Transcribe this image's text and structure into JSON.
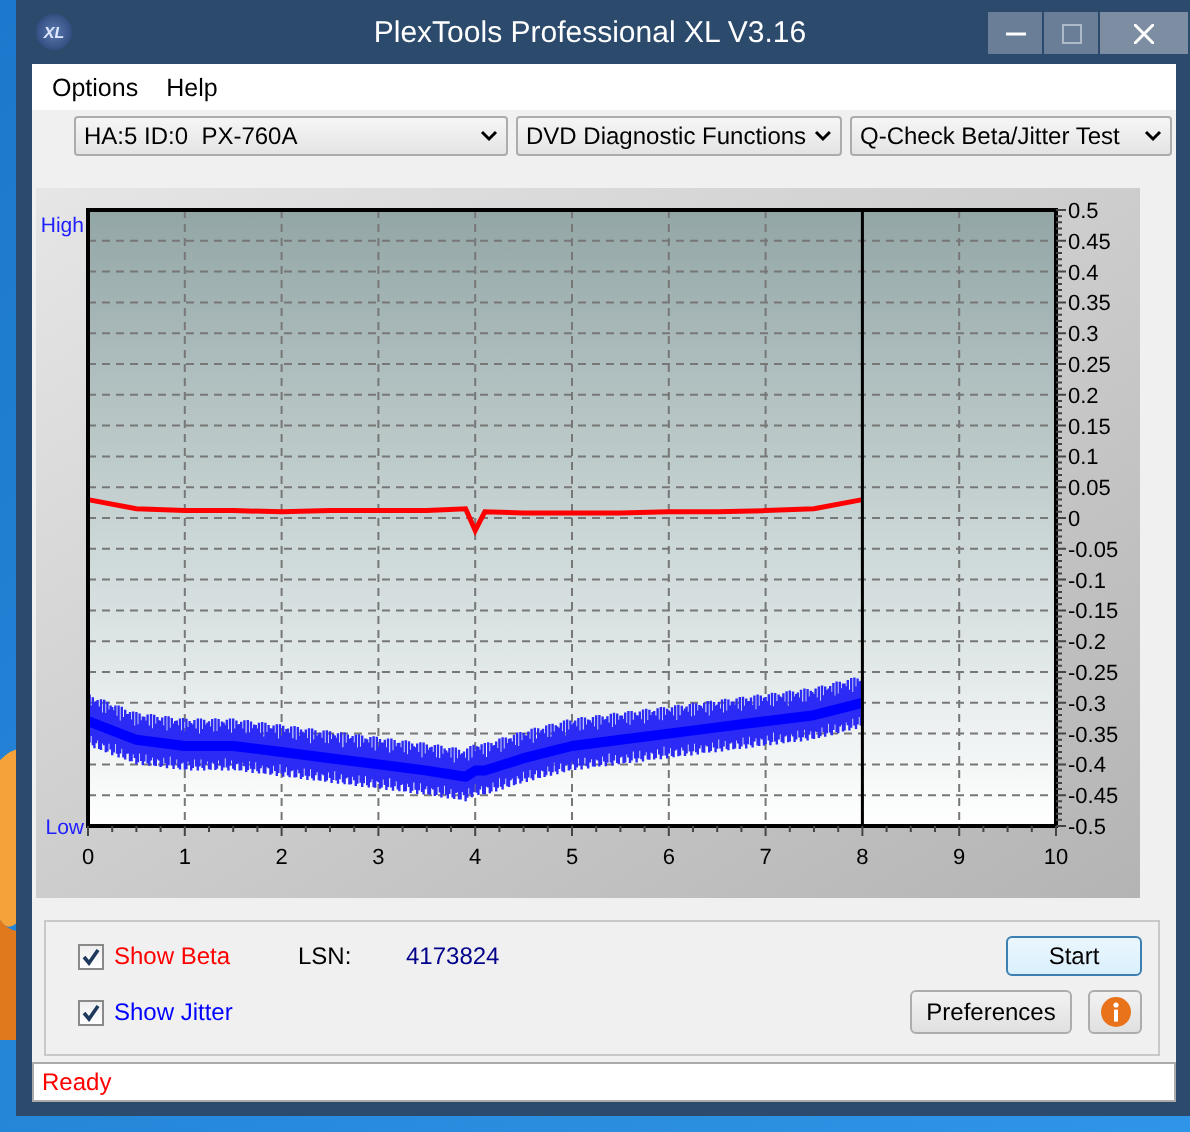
{
  "window": {
    "title": "PlexTools Professional XL V3.16",
    "icon_label": "XL",
    "controls": [
      {
        "kind": "minimize",
        "disabled": false
      },
      {
        "kind": "maximize",
        "disabled": true
      },
      {
        "kind": "close",
        "disabled": false
      }
    ]
  },
  "menu": [
    "Options",
    "Help"
  ],
  "dropdowns": [
    {
      "value": "HA:5 ID:0  PX-760A"
    },
    {
      "value": "DVD Diagnostic Functions"
    },
    {
      "value": "Q-Check Beta/Jitter Test"
    }
  ],
  "chart": {
    "high_label": "High",
    "low_label": "Low",
    "chart_data": {
      "type": "line",
      "grid": true,
      "ref_lines": [
        {
          "axis": "x",
          "value": 8,
          "color": "#000000"
        }
      ],
      "x": [
        0,
        0.5,
        1,
        1.5,
        2,
        2.5,
        3,
        3.5,
        3.9,
        4,
        4.1,
        4.5,
        5,
        5.5,
        6,
        6.5,
        7,
        7.5,
        8
      ],
      "series": [
        {
          "color": "#ff0000",
          "values": [
            0.03,
            0.015,
            0.012,
            0.012,
            0.01,
            0.012,
            0.012,
            0.012,
            0.015,
            -0.02,
            0.01,
            0.008,
            0.008,
            0.008,
            0.01,
            0.01,
            0.012,
            0.015,
            0.03
          ]
        },
        {
          "color": "#0000ff",
          "values": [
            -0.33,
            -0.36,
            -0.37,
            -0.37,
            -0.38,
            -0.39,
            -0.4,
            -0.41,
            -0.42,
            -0.41,
            -0.41,
            -0.39,
            -0.37,
            -0.36,
            -0.35,
            -0.34,
            -0.33,
            -0.32,
            -0.3
          ]
        }
      ],
      "xlim": [
        0,
        10
      ],
      "ylim": [
        -0.5,
        0.5
      ],
      "xticks": [
        0,
        1,
        2,
        3,
        4,
        5,
        6,
        7,
        8,
        9,
        10
      ],
      "yticks": [
        {
          "value": 0.5,
          "label": "0.5"
        },
        {
          "value": 0.45,
          "label": "0.45"
        },
        {
          "value": 0.4,
          "label": "0.4"
        },
        {
          "value": 0.35,
          "label": "0.35"
        },
        {
          "value": 0.3,
          "label": "0.3"
        },
        {
          "value": 0.25,
          "label": "0.25"
        },
        {
          "value": 0.2,
          "label": "0.2"
        },
        {
          "value": 0.15,
          "label": "0.15"
        },
        {
          "value": 0.1,
          "label": "0.1"
        },
        {
          "value": 0.05,
          "label": "0.05"
        },
        {
          "value": 0,
          "label": "0"
        },
        {
          "value": -0.05,
          "label": "-0.05"
        },
        {
          "value": -0.1,
          "label": "-0.1"
        },
        {
          "value": -0.15,
          "label": "-0.15"
        },
        {
          "value": -0.2,
          "label": "-0.2"
        },
        {
          "value": -0.25,
          "label": "-0.25"
        },
        {
          "value": -0.3,
          "label": "-0.3"
        },
        {
          "value": -0.35,
          "label": "-0.35"
        },
        {
          "value": -0.4,
          "label": "-0.4"
        },
        {
          "value": -0.45,
          "label": "-0.45"
        },
        {
          "value": -0.5,
          "label": "-0.5"
        }
      ]
    }
  },
  "options": [
    {
      "label": "Show Beta",
      "checked": true,
      "color": "#ff0000"
    },
    {
      "label": "Show Jitter",
      "checked": true,
      "color": "#0000ff"
    }
  ],
  "lsn": {
    "label": "LSN:",
    "value": "4173824"
  },
  "buttons": {
    "start": "Start",
    "preferences": "Preferences"
  },
  "status_bar": {
    "text": "Ready"
  }
}
